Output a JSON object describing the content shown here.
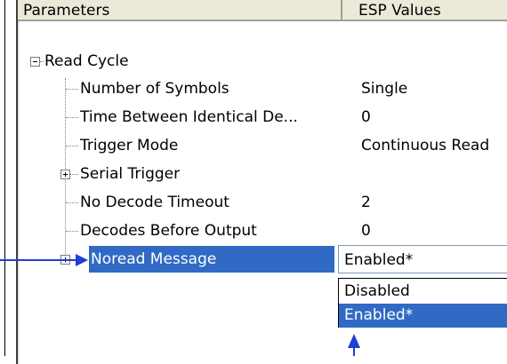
{
  "columns": {
    "parameters": "Parameters",
    "values": "ESP Values"
  },
  "tree": {
    "root_label": "Read Cycle",
    "items": [
      {
        "label": "Number of Symbols",
        "value": "Single"
      },
      {
        "label": "Time Between Identical De...",
        "value": "0"
      },
      {
        "label": "Trigger Mode",
        "value": "Continuous Read"
      },
      {
        "label": "Serial Trigger",
        "value": ""
      },
      {
        "label": "No Decode Timeout",
        "value": "2"
      },
      {
        "label": "Decodes Before Output",
        "value": "0"
      },
      {
        "label": "Noread Message",
        "value": "Enabled*"
      }
    ]
  },
  "dropdown": {
    "selected": "Enabled*",
    "options": [
      "Disabled",
      "Enabled*"
    ]
  },
  "colors": {
    "selection": "#316ac5",
    "arrow": "#1c3fd6",
    "header_bg": "#ece9d8"
  }
}
